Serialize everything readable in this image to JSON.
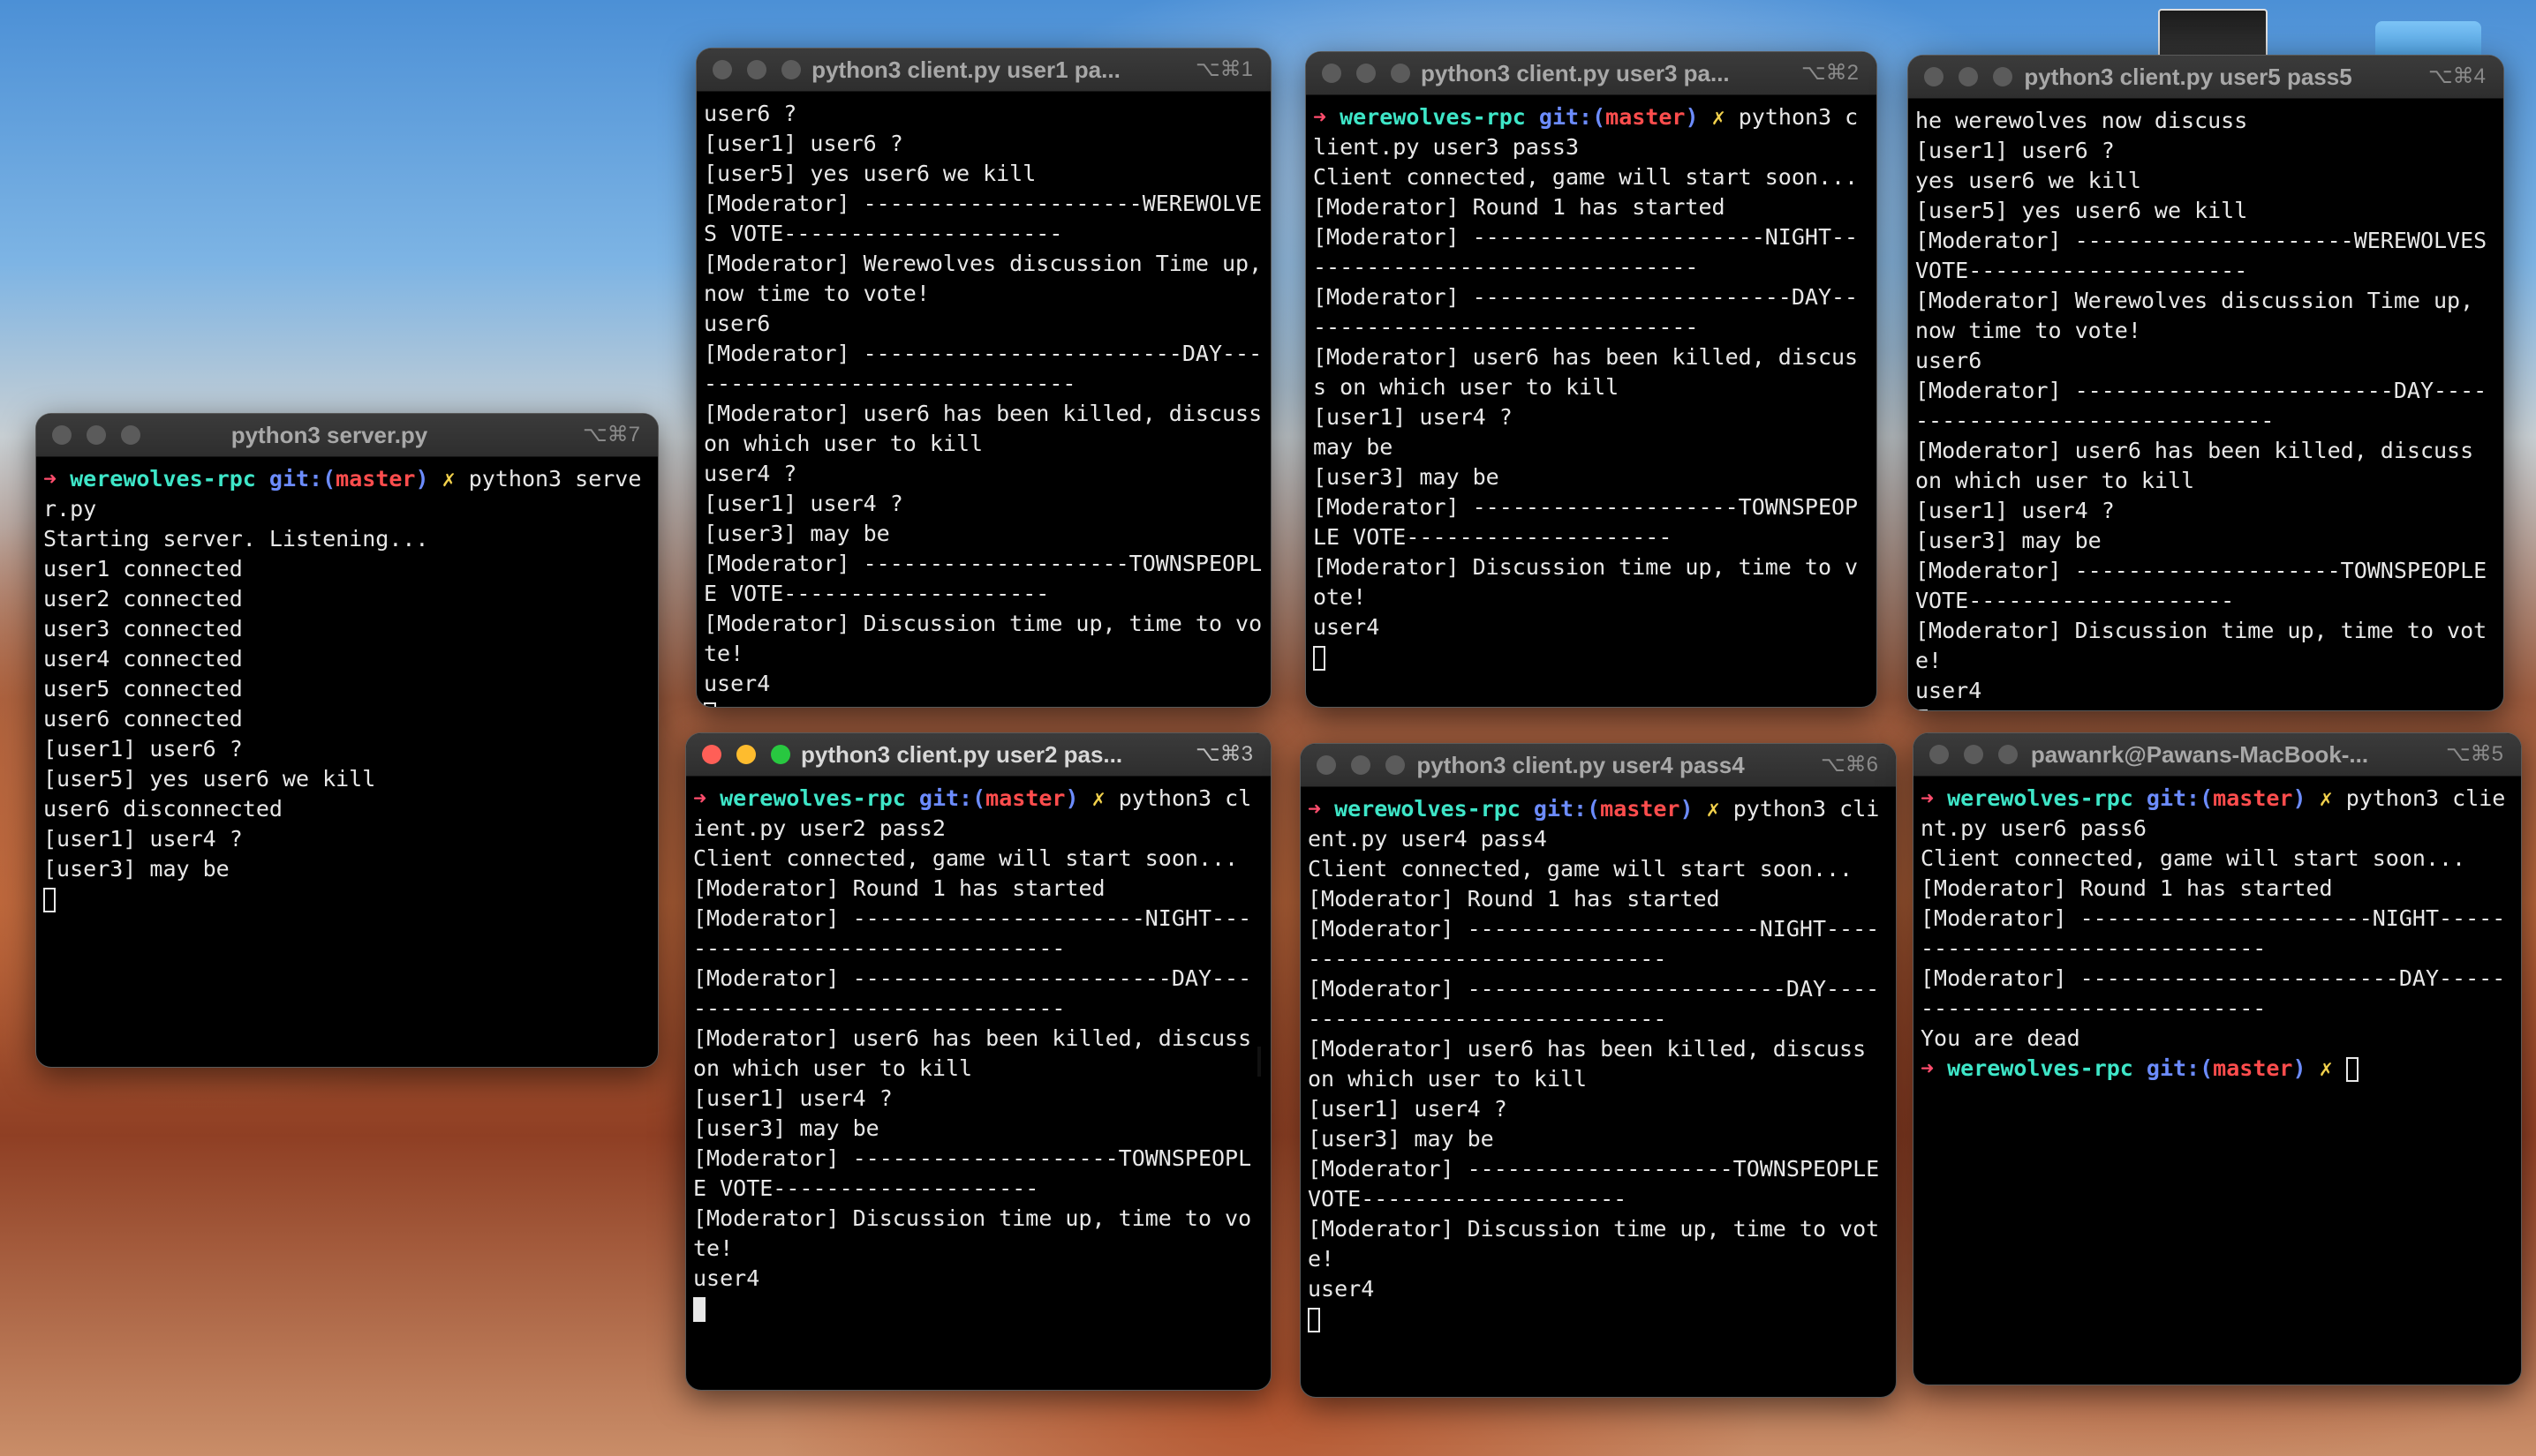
{
  "windows": {
    "server": {
      "title": "python3 server.py",
      "shortcut": "⌥⌘7",
      "prompt": {
        "arrow": "➜",
        "dir": "werewolves-rpc",
        "git": "git:(",
        "branch": "master",
        "git_close": ")",
        "dirty": "✗",
        "cmd": "python3 server.py"
      },
      "lines": [
        "Starting server. Listening...",
        "user1 connected",
        "user2 connected",
        "user3 connected",
        "user4 connected",
        "user5 connected",
        "user6 connected",
        "[user1] user6 ?",
        "[user5] yes user6 we kill",
        "user6 disconnected",
        "[user1] user4 ?",
        "[user3] may be"
      ]
    },
    "user1": {
      "title": "python3 client.py user1 pa...",
      "shortcut": "⌥⌘1",
      "lines": [
        "user6 ?",
        "[user1] user6 ?",
        "[user5] yes user6 we kill",
        "[Moderator] ---------------------WEREWOLVES VOTE---------------------",
        "[Moderator] Werewolves discussion Time up, now time to vote!",
        "user6",
        "[Moderator] ------------------------DAY-------------------------------",
        "[Moderator] user6 has been killed, discuss on which user to kill",
        "user4 ?",
        "[user1] user4 ?",
        "[user3] may be",
        "[Moderator] --------------------TOWNSPEOPLE VOTE--------------------",
        "[Moderator] Discussion time up, time to vote!",
        "user4"
      ]
    },
    "user3": {
      "title": "python3 client.py user3 pa...",
      "shortcut": "⌥⌘2",
      "prompt": {
        "arrow": "➜",
        "dir": "werewolves-rpc",
        "git": "git:(",
        "branch": "master",
        "git_close": ")",
        "dirty": "✗",
        "cmd": "python3 client.py user3 pass3"
      },
      "lines": [
        "Client connected, game will start soon...",
        "[Moderator] Round 1 has started",
        "[Moderator] ----------------------NIGHT-------------------------------",
        "[Moderator] ------------------------DAY-------------------------------",
        "[Moderator] user6 has been killed, discuss on which user to kill",
        "[user1] user4 ?",
        "may be",
        "[user3] may be",
        "[Moderator] --------------------TOWNSPEOPLE VOTE--------------------",
        "[Moderator] Discussion time up, time to vote!",
        "user4"
      ]
    },
    "user5": {
      "title": "python3 client.py user5 pass5",
      "shortcut": "⌥⌘4",
      "lines": [
        "he werewolves now discuss",
        "[user1] user6 ?",
        "yes user6 we kill",
        "[user5] yes user6 we kill",
        "[Moderator] ---------------------WEREWOLVES VOTE---------------------",
        "[Moderator] Werewolves discussion Time up, now time to vote!",
        "user6",
        "[Moderator] ------------------------DAY-------------------------------",
        "[Moderator] user6 has been killed, discuss on which user to kill",
        "[user1] user4 ?",
        "[user3] may be",
        "[Moderator] --------------------TOWNSPEOPLE VOTE--------------------",
        "[Moderator] Discussion time up, time to vote!",
        "user4"
      ]
    },
    "user2": {
      "title": "python3 client.py user2 pas...",
      "shortcut": "⌥⌘3",
      "prompt": {
        "arrow": "➜",
        "dir": "werewolves-rpc",
        "git": "git:(",
        "branch": "master",
        "git_close": ")",
        "dirty": "✗",
        "cmd": "python3 client.py user2 pass2"
      },
      "lines": [
        "Client connected, game will start soon...",
        "[Moderator] Round 1 has started",
        "[Moderator] ----------------------NIGHT-------------------------------",
        "[Moderator] ------------------------DAY-------------------------------",
        "[Moderator] user6 has been killed, discuss on which user to kill",
        "[user1] user4 ?",
        "[user3] may be",
        "[Moderator] --------------------TOWNSPEOPLE VOTE--------------------",
        "[Moderator] Discussion time up, time to vote!",
        "user4"
      ]
    },
    "user4": {
      "title": "python3 client.py user4 pass4",
      "shortcut": "⌥⌘6",
      "prompt": {
        "arrow": "➜",
        "dir": "werewolves-rpc",
        "git": "git:(",
        "branch": "master",
        "git_close": ")",
        "dirty": "✗",
        "cmd": "python3 client.py user4 pass4"
      },
      "lines": [
        "Client connected, game will start soon...",
        "[Moderator] Round 1 has started",
        "[Moderator] ----------------------NIGHT-------------------------------",
        "[Moderator] ------------------------DAY-------------------------------",
        "[Moderator] user6 has been killed, discuss on which user to kill",
        "[user1] user4 ?",
        "[user3] may be",
        "[Moderator] --------------------TOWNSPEOPLE VOTE--------------------",
        "[Moderator] Discussion time up, time to vote!",
        "user4"
      ]
    },
    "user6": {
      "title": "pawanrk@Pawans-MacBook-...",
      "shortcut": "⌥⌘5",
      "prompt": {
        "arrow": "➜",
        "dir": "werewolves-rpc",
        "git": "git:(",
        "branch": "master",
        "git_close": ")",
        "dirty": "✗",
        "cmd": "python3 client.py user6 pass6"
      },
      "lines": [
        "Client connected, game will start soon...",
        "[Moderator] Round 1 has started",
        "[Moderator] ----------------------NIGHT-------------------------------",
        "[Moderator] ------------------------DAY-------------------------------",
        "You are dead"
      ],
      "end_prompt": {
        "arrow": "➜",
        "dir": "werewolves-rpc",
        "git": "git:(",
        "branch": "master",
        "git_close": ")",
        "dirty": "✗"
      }
    }
  },
  "colors": {
    "accent_red": "#ff5f57",
    "accent_yellow": "#febc2e",
    "accent_green": "#28c840",
    "prompt_cyan": "#3ee6c8",
    "prompt_blue": "#6c8cff"
  }
}
